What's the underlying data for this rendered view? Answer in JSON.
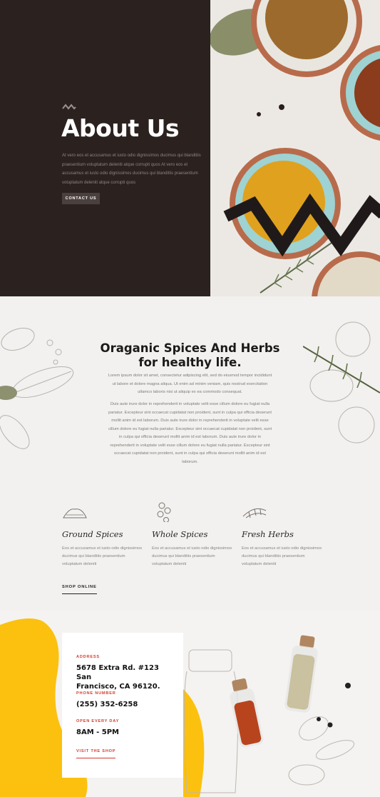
{
  "hero": {
    "title": "About Us",
    "text": "At vero eos et accusamus et iusto odio dignissimos ducimus qui blanditiis praesentium voluptatum deleniti atque corrupti quos At vero eos et accusamus et iusto odio dignissimos ducimus qui blanditiis praesentium voluptatum deleniti atque corrupti quos",
    "button_label": "CONTACT US"
  },
  "intro": {
    "title_line1": "Oraganic Spices And Herbs",
    "title_line2": "for healthy life.",
    "paragraph1": "Lorem ipsum dolor sit amet, consectetur adipiscing elit, sed do eiusmod tempor incididunt ut labore et dolore magna aliqua. Ut enim ad minim veniam, quis nostrud exercitation ullamco laboris nisi ut aliquip ex ea commodo consequat.",
    "paragraph2": "Duis aute irure dolor in reprehenderit in voluptate velit esse cillum dolore eu fugiat nulla pariatur. Excepteur sint occaecat cupidatat non proident, sunt in culpa qui officia deserunt mollit anim id est laborum. Duis aute irure dolor in reprehenderit in voluptate velit esse cillum dolore eu fugiat nulla pariatur. Excepteur sint occaecat cupidatat non proident, sunt in culpa qui officia deserunt mollit anim id est laborum. Duis aute irure dolor in reprehenderit in voluptate velit esse cillum dolore eu fugiat nulla pariatur. Excepteur sint occaecat cupidatat non proident, sunt in culpa qui officia deserunt mollit anim id est laborum."
  },
  "features": [
    {
      "title": "Ground Spices",
      "text": "Eos et accusamus et iusto odio dignissimos ducimus qui blanditiis praesentium voluptatum deleniti",
      "icon": "ground-spice-icon"
    },
    {
      "title": "Whole Spices",
      "text": "Eos et accusamus et iusto odio dignissimos ducimus qui blanditiis praesentium voluptatum deleniti",
      "icon": "whole-spice-icon"
    },
    {
      "title": "Fresh Herbs",
      "text": "Eos et accusamus et iusto odio dignissimos ducimus qui blanditiis praesentium voluptatum deleniti",
      "icon": "herb-icon"
    }
  ],
  "shop_link": "SHOP ONLINE",
  "contact_card": {
    "address_label": "ADDRESS",
    "address_line1": "5678 Extra Rd. #123 San",
    "address_line2": "Francisco, CA 96120.",
    "phone_label": "PHONE NUMBER",
    "phone": "(255) 352-6258",
    "hours_label": "OPEN EVERY DAY",
    "hours": "8AM - 5PM",
    "visit_label": "VISIT THE SHOP"
  },
  "colors": {
    "hero_dark": "#2b2220",
    "accent_red": "#d63a2a",
    "accent_yellow": "#fcc10f",
    "turmeric": "#e6a21c"
  }
}
